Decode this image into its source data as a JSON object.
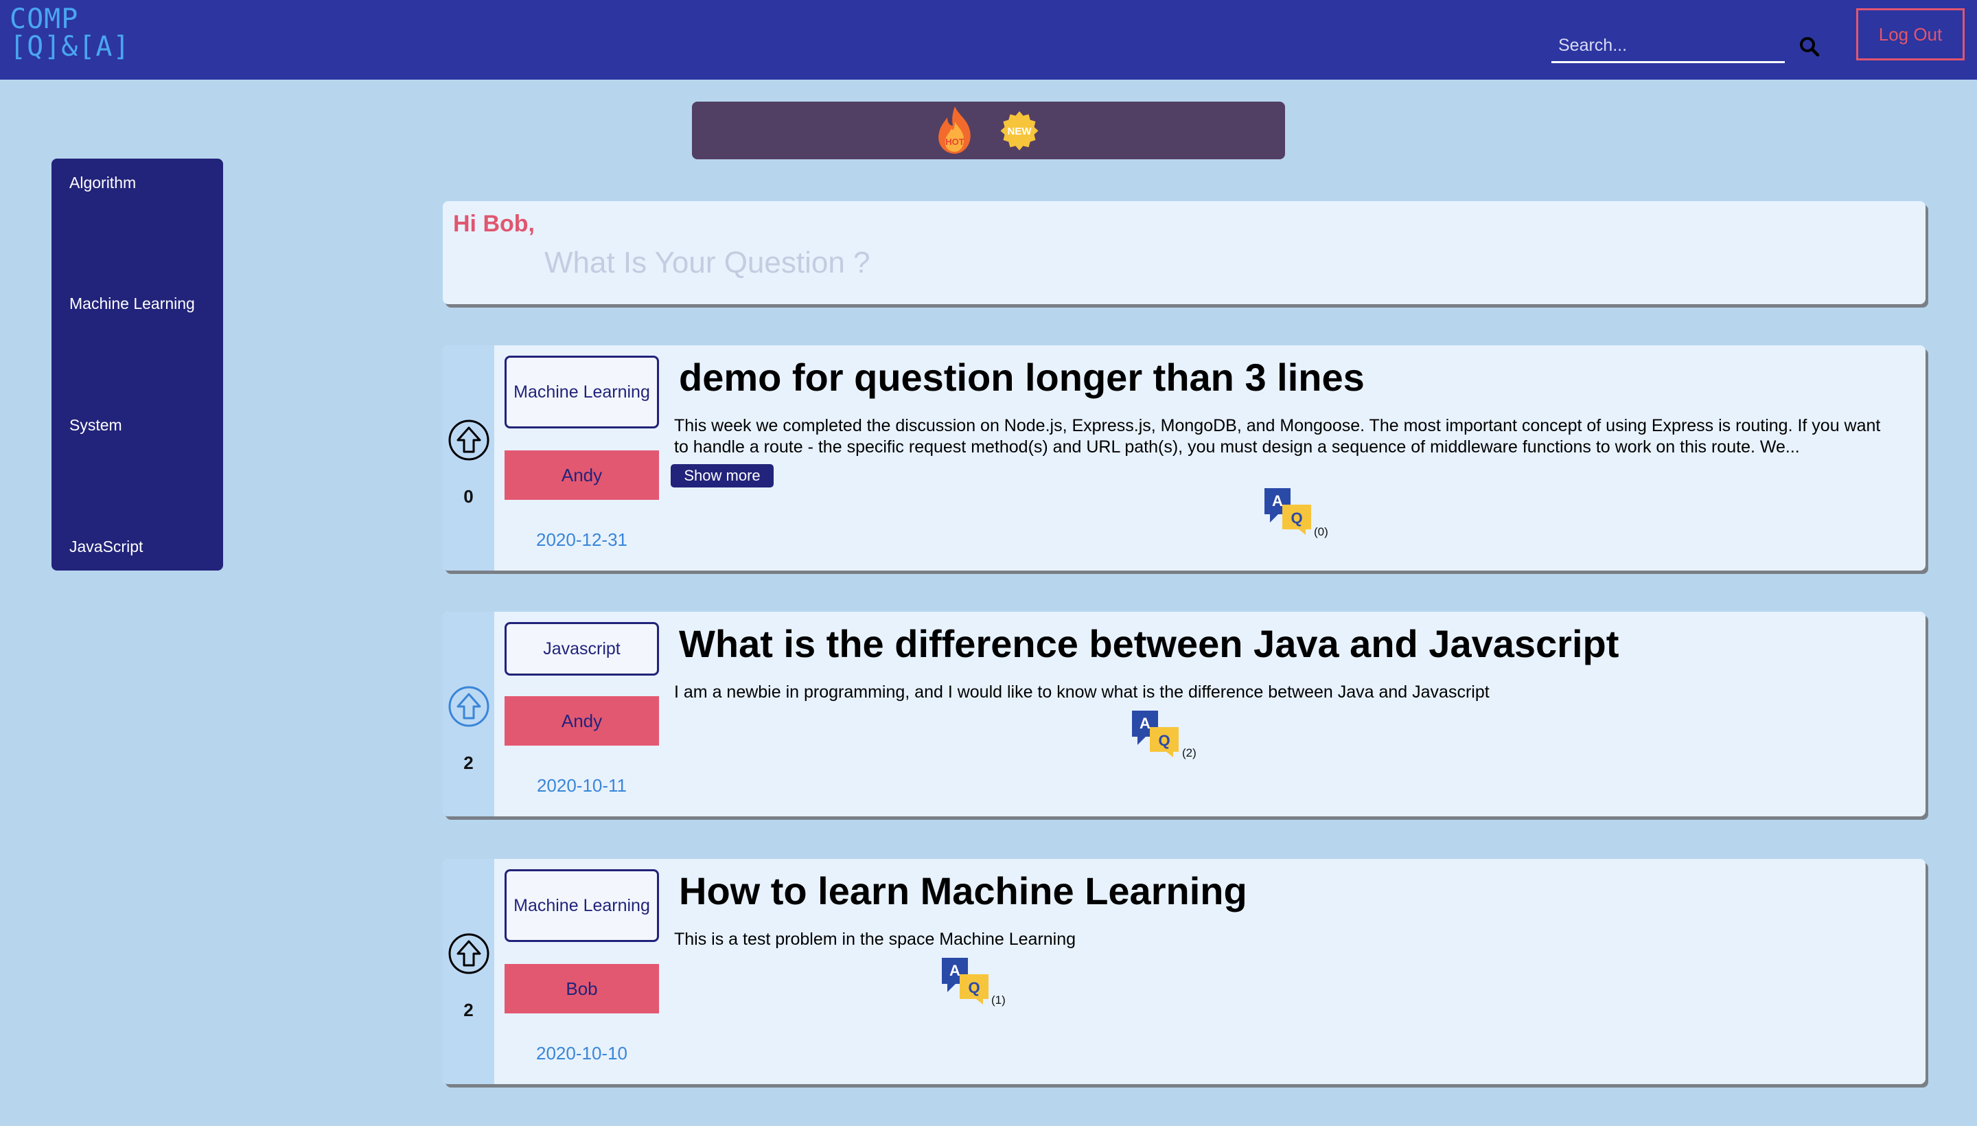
{
  "header": {
    "logo_line1": "COMP",
    "logo_line2": "[Q]&[A]",
    "search_placeholder": "Search...",
    "logout_label": "Log Out"
  },
  "filters": [
    "hot",
    "new"
  ],
  "filter_labels": {
    "hot": "HOT",
    "new": "NEW"
  },
  "sidebar": {
    "items": [
      {
        "label": "Algorithm"
      },
      {
        "label": "Machine Learning"
      },
      {
        "label": "System"
      },
      {
        "label": "JavaScript"
      }
    ]
  },
  "ask": {
    "greeting": "Hi Bob,",
    "placeholder": "What Is Your Question ?"
  },
  "questions": [
    {
      "votes": "0",
      "tag": "Machine Learning",
      "author": "Andy",
      "date": "2020-12-31",
      "title": "demo for question longer than 3 lines",
      "body": "This week we completed the discussion on Node.js, Express.js, MongoDB, and Mongoose. The most important concept of using Express is routing. If you want to handle a route - the specific request method(s) and URL path(s), you must design a sequence of middleware functions to work on this route. We...",
      "show_more": "Show more",
      "answers": "(0)"
    },
    {
      "votes": "2",
      "tag": "Javascript",
      "author": "Andy",
      "date": "2020-10-11",
      "title": "What is the difference between Java and Javascript",
      "body": "I am a newbie in programming, and I would like to know what is the difference between Java and Javascript",
      "answers": "(2)"
    },
    {
      "votes": "2",
      "tag": "Machine Learning",
      "author": "Bob",
      "date": "2020-10-10",
      "title": "How to learn Machine Learning",
      "body": "This is a test problem in the space Machine Learning",
      "answers": "(1)"
    }
  ],
  "colors": {
    "header_bg": "#2c35a0",
    "page_bg": "#b7d6ee",
    "sidebar_bg": "#22237a",
    "accent_pink": "#e35871",
    "date_blue": "#3a86d8",
    "filter_bar": "#523f64"
  }
}
